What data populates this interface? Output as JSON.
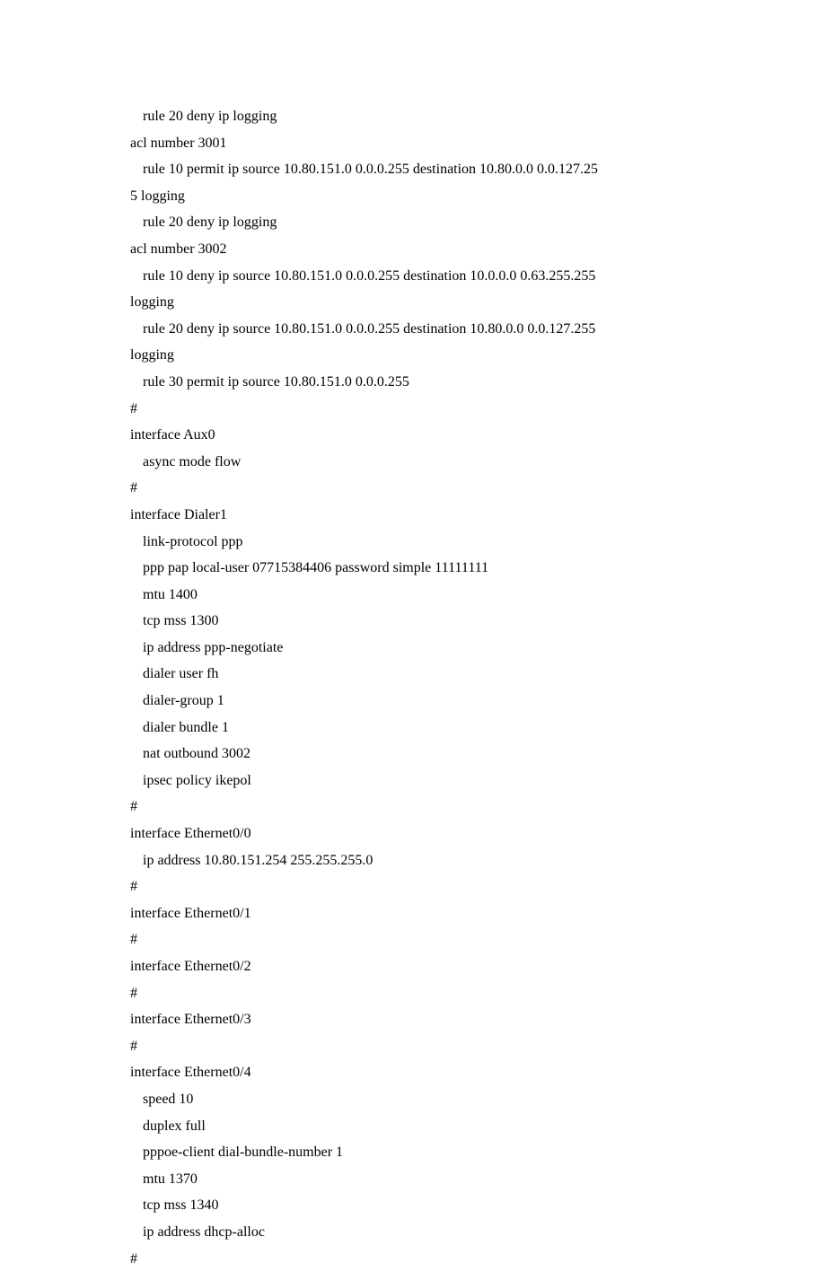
{
  "lines": [
    {
      "text": "rule 20 deny ip logging",
      "indent": true
    },
    {
      "text": "acl number 3001",
      "indent": false
    },
    {
      "text": "rule 10 permit ip source 10.80.151.0 0.0.0.255 destination 10.80.0.0 0.0.127.25",
      "indent": true
    },
    {
      "text": "5 logging",
      "indent": false
    },
    {
      "text": "rule 20 deny ip logging",
      "indent": true
    },
    {
      "text": "acl number 3002",
      "indent": false
    },
    {
      "text": "rule 10 deny ip source 10.80.151.0 0.0.0.255 destination 10.0.0.0 0.63.255.255 ",
      "indent": true
    },
    {
      "text": "logging",
      "indent": false
    },
    {
      "text": "rule 20 deny ip source 10.80.151.0 0.0.0.255 destination 10.80.0.0 0.0.127.255 ",
      "indent": true
    },
    {
      "text": "logging",
      "indent": false
    },
    {
      "text": "rule 30 permit ip source 10.80.151.0 0.0.0.255",
      "indent": true
    },
    {
      "text": "#",
      "indent": false
    },
    {
      "text": "interface Aux0",
      "indent": false
    },
    {
      "text": "async mode flow",
      "indent": true
    },
    {
      "text": "#",
      "indent": false
    },
    {
      "text": "interface Dialer1",
      "indent": false
    },
    {
      "text": "link-protocol ppp",
      "indent": true
    },
    {
      "text": "ppp pap local-user 07715384406 password simple 11111111",
      "indent": true
    },
    {
      "text": "mtu 1400",
      "indent": true
    },
    {
      "text": "tcp mss 1300",
      "indent": true
    },
    {
      "text": "ip address ppp-negotiate",
      "indent": true
    },
    {
      "text": "dialer user fh",
      "indent": true
    },
    {
      "text": "dialer-group 1",
      "indent": true
    },
    {
      "text": "dialer bundle 1",
      "indent": true
    },
    {
      "text": "nat outbound 3002",
      "indent": true
    },
    {
      "text": "ipsec policy ikepol",
      "indent": true
    },
    {
      "text": "#",
      "indent": false
    },
    {
      "text": "interface Ethernet0/0",
      "indent": false
    },
    {
      "text": "ip address 10.80.151.254 255.255.255.0",
      "indent": true
    },
    {
      "text": "#",
      "indent": false
    },
    {
      "text": "interface Ethernet0/1",
      "indent": false
    },
    {
      "text": "#",
      "indent": false
    },
    {
      "text": "interface Ethernet0/2",
      "indent": false
    },
    {
      "text": "#",
      "indent": false
    },
    {
      "text": "interface Ethernet0/3",
      "indent": false
    },
    {
      "text": "#",
      "indent": false
    },
    {
      "text": "interface Ethernet0/4",
      "indent": false
    },
    {
      "text": "speed 10",
      "indent": true
    },
    {
      "text": "duplex full",
      "indent": true
    },
    {
      "text": "pppoe-client dial-bundle-number 1",
      "indent": true
    },
    {
      "text": "mtu 1370",
      "indent": true
    },
    {
      "text": "tcp mss 1340",
      "indent": true
    },
    {
      "text": "ip address dhcp-alloc",
      "indent": true
    },
    {
      "text": "#",
      "indent": false
    }
  ]
}
